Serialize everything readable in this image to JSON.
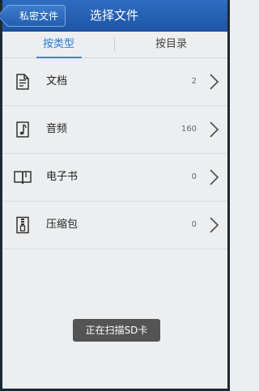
{
  "header": {
    "back_label": "私密文件",
    "title": "选择文件"
  },
  "tabs": [
    {
      "label": "按类型",
      "active": true
    },
    {
      "label": "按目录",
      "active": false
    }
  ],
  "list": [
    {
      "label": "文档",
      "count": "2",
      "icon": "document-icon"
    },
    {
      "label": "音频",
      "count": "160",
      "icon": "music-note-icon"
    },
    {
      "label": "电子书",
      "count": "0",
      "icon": "book-icon"
    },
    {
      "label": "压缩包",
      "count": "0",
      "icon": "zip-archive-icon"
    }
  ],
  "toast": {
    "text": "正在扫描SD卡"
  },
  "colors": {
    "header": "#2a64b6",
    "active_tab": "#2f7bd3",
    "background": "#eceef0"
  }
}
